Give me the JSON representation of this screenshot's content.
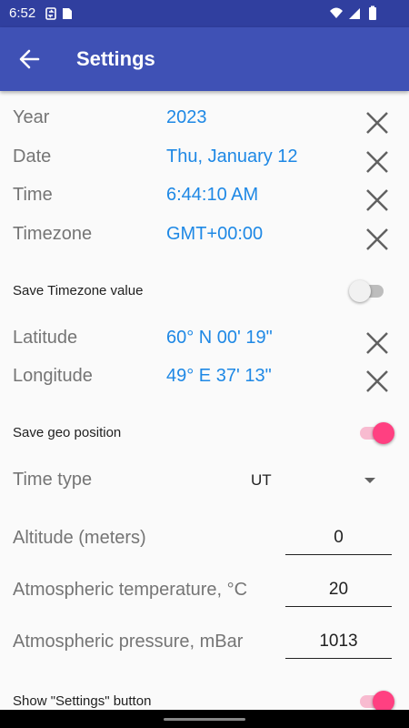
{
  "status_bar": {
    "time": "6:52"
  },
  "app_bar": {
    "title": "Settings"
  },
  "fields": [
    {
      "label": "Year",
      "value": "2023"
    },
    {
      "label": "Date",
      "value": "Thu, January 12"
    },
    {
      "label": "Time",
      "value": "6:44:10 AM"
    },
    {
      "label": "Timezone",
      "value": "GMT+00:00"
    }
  ],
  "save_timezone": {
    "label": "Save Timezone value",
    "enabled": false
  },
  "geo_fields": [
    {
      "label": "Latitude",
      "value": "60° N 00' 19\""
    },
    {
      "label": "Longitude",
      "value": "49° E 37' 13\""
    }
  ],
  "save_geo": {
    "label": "Save geo position",
    "enabled": true
  },
  "time_type": {
    "label": "Time type",
    "selected": "UT"
  },
  "altitude": {
    "label": "Altitude (meters)",
    "value": "0"
  },
  "temperature": {
    "label": "Atmospheric temperature, °C",
    "value": "20"
  },
  "pressure": {
    "label": "Atmospheric pressure, mBar",
    "value": "1013"
  },
  "show_settings": {
    "label": "Show \"Settings\" button",
    "enabled": true
  },
  "colors": {
    "app_bar": "#3f51b5",
    "status_bar": "#303f9f",
    "value_text": "#1e88e5",
    "switch_accent": "#ff4081"
  }
}
